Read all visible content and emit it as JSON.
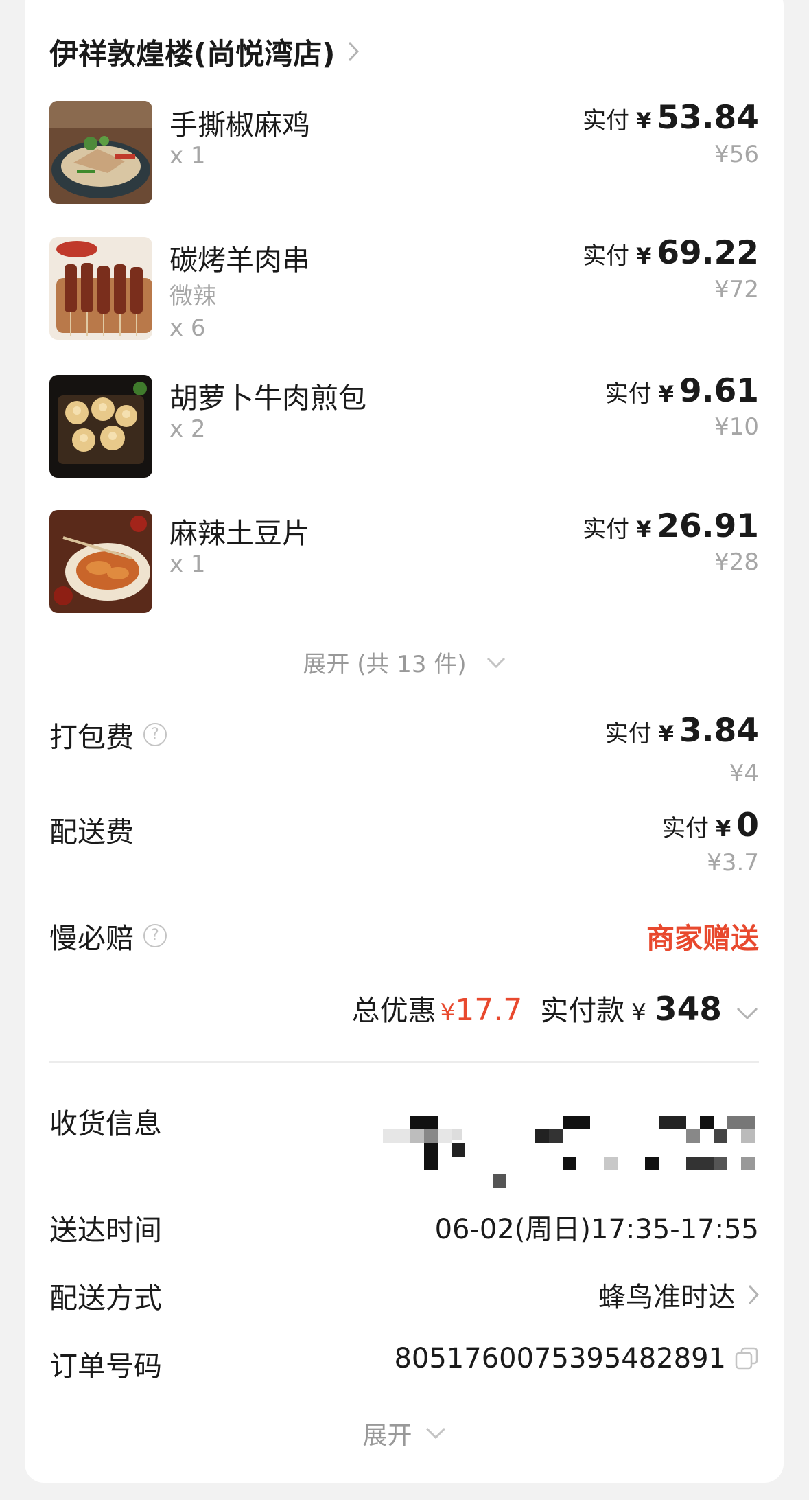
{
  "shop": {
    "name": "伊祥敦煌楼(尚悦湾店)"
  },
  "items": [
    {
      "name": "手撕椒麻鸡",
      "spec": "",
      "qty": "x 1",
      "pay_label": "实付",
      "yen": "¥",
      "pay": "53.84",
      "original": "¥56"
    },
    {
      "name": "碳烤羊肉串",
      "spec": "微辣",
      "qty": "x 6",
      "pay_label": "实付",
      "yen": "¥",
      "pay": "69.22",
      "original": "¥72"
    },
    {
      "name": "胡萝卜牛肉煎包",
      "spec": "",
      "qty": "x 2",
      "pay_label": "实付",
      "yen": "¥",
      "pay": "9.61",
      "original": "¥10"
    },
    {
      "name": "麻辣土豆片",
      "spec": "",
      "qty": "x 1",
      "pay_label": "实付",
      "yen": "¥",
      "pay": "26.91",
      "original": "¥28"
    }
  ],
  "expand_items": "展开 (共 13 件)",
  "fees": {
    "packing": {
      "label": "打包费",
      "pay_label": "实付",
      "yen": "¥",
      "pay": "3.84",
      "original": "¥4"
    },
    "delivery": {
      "label": "配送费",
      "pay_label": "实付",
      "yen": "¥",
      "pay": "0",
      "original": "¥3.7"
    },
    "guarantee": {
      "label": "慢必赔",
      "value": "商家赠送"
    }
  },
  "totals": {
    "discount_label": "总优惠",
    "discount_yen": "¥",
    "discount": "17.7",
    "paid_label": "实付款",
    "paid_yen": "¥",
    "paid": "348"
  },
  "info": {
    "address_label": "收货信息",
    "time_label": "送达时间",
    "time_value": "06-02(周日)17:35-17:55",
    "method_label": "配送方式",
    "method_value": "蜂鸟准时达",
    "order_label": "订单号码",
    "order_value": "8051760075395482891"
  },
  "expand_more": "展开",
  "colors": {
    "accent_red": "#e8492e",
    "muted": "#a6a6a6",
    "background": "#f2f2f2"
  },
  "icons": [
    "chevron-right-icon",
    "chevron-down-icon",
    "question-circle-icon",
    "copy-icon"
  ]
}
